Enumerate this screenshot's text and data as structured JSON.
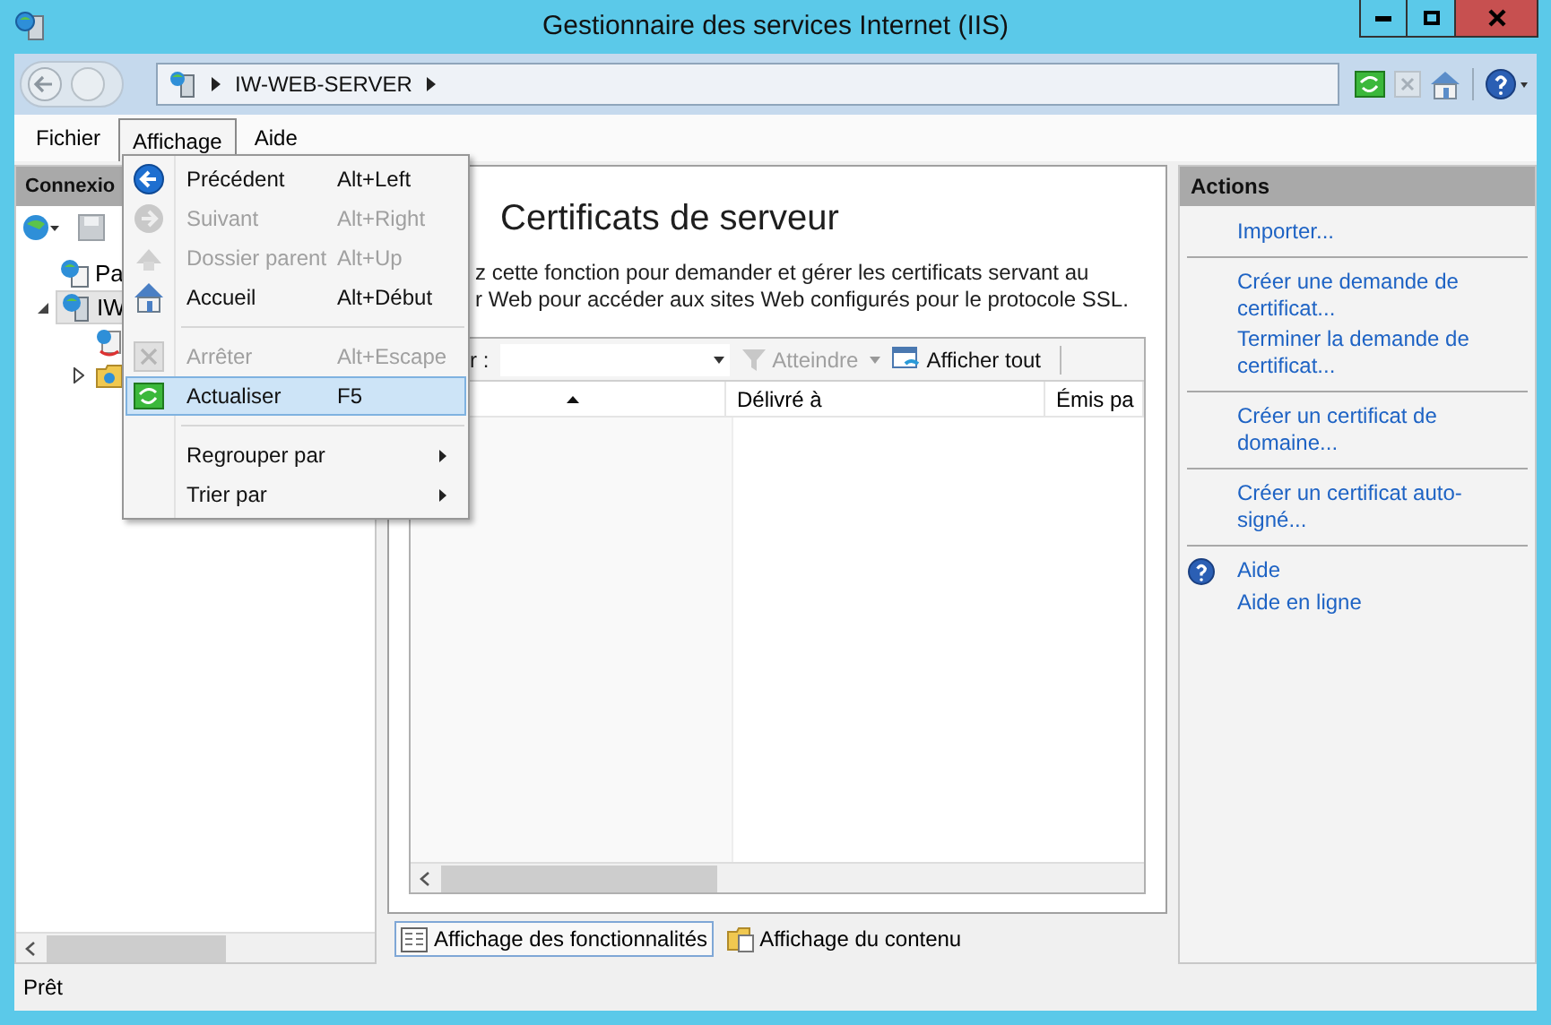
{
  "window": {
    "title": "Gestionnaire des services Internet (IIS)"
  },
  "address_bar": {
    "segments": [
      "IW-WEB-SERVER"
    ]
  },
  "menu_bar": [
    {
      "label": "Fichier",
      "selected": false
    },
    {
      "label": "Affichage",
      "selected": true
    },
    {
      "label": "Aide",
      "selected": false
    }
  ],
  "menu": [
    {
      "kind": "item",
      "label": "Précédent",
      "shortcut": "Alt+Left",
      "disabled": false,
      "selected": false
    },
    {
      "kind": "item",
      "label": "Suivant",
      "shortcut": "Alt+Right",
      "disabled": true,
      "selected": false
    },
    {
      "kind": "item",
      "label": "Dossier parent",
      "shortcut": "Alt+Up",
      "disabled": true,
      "selected": false
    },
    {
      "kind": "item",
      "label": "Accueil",
      "shortcut": "Alt+Début",
      "disabled": false,
      "selected": false
    },
    {
      "kind": "separator"
    },
    {
      "kind": "item",
      "label": "Arrêter",
      "shortcut": "Alt+Escape",
      "disabled": true,
      "selected": false
    },
    {
      "kind": "item",
      "label": "Actualiser",
      "shortcut": "F5",
      "disabled": false,
      "selected": true
    },
    {
      "kind": "separator"
    },
    {
      "kind": "submenu",
      "label": "Regrouper par",
      "disabled": false,
      "selected": false
    },
    {
      "kind": "submenu",
      "label": "Trier par",
      "disabled": false,
      "selected": false
    }
  ],
  "connections": {
    "header": "Connexio",
    "tree": [
      {
        "kind": "start",
        "label": "Pa",
        "selected": false
      },
      {
        "kind": "server",
        "label": "IW",
        "selected": true,
        "expanded": true,
        "children": [
          {
            "kind": "pools",
            "selected": false
          },
          {
            "kind": "sites",
            "selected": false,
            "expanded": false
          }
        ]
      }
    ]
  },
  "content": {
    "title": "Certificats de serveur",
    "description": [
      "z cette fonction pour demander et gérer les certificats servant au",
      "r Web pour accéder aux sites Web configurés pour le protocole SSL."
    ],
    "filter": {
      "label": "r :"
    },
    "toolbar": [
      {
        "kind": "goto",
        "label": "Atteindre",
        "disabled": true
      },
      {
        "kind": "showall",
        "label": "Afficher tout",
        "disabled": false
      }
    ],
    "columns": [
      {
        "sorted": true
      },
      {
        "label": "Délivré à",
        "sorted": false
      },
      {
        "label": "Émis pa",
        "sorted": false
      }
    ],
    "view_tabs": [
      {
        "kind": "features",
        "label": "Affichage des fonctionnalités",
        "selected": true
      },
      {
        "kind": "content",
        "label": "Affichage du contenu",
        "selected": false
      }
    ]
  },
  "actions": {
    "header": "Actions",
    "groups": [
      [
        {
          "kind": "link",
          "label": "Importer..."
        }
      ],
      [
        {
          "kind": "link",
          "label": "Créer une demande de certificat..."
        },
        {
          "kind": "link",
          "label": "Terminer la demande de certificat..."
        }
      ],
      [
        {
          "kind": "link",
          "label": "Créer un certificat de domaine..."
        }
      ],
      [
        {
          "kind": "link",
          "label": "Créer un certificat auto-signé..."
        }
      ],
      [
        {
          "kind": "help",
          "label": "Aide"
        },
        {
          "kind": "link",
          "label": "Aide en ligne"
        }
      ]
    ]
  },
  "status_bar": {
    "text": "Prêt"
  }
}
